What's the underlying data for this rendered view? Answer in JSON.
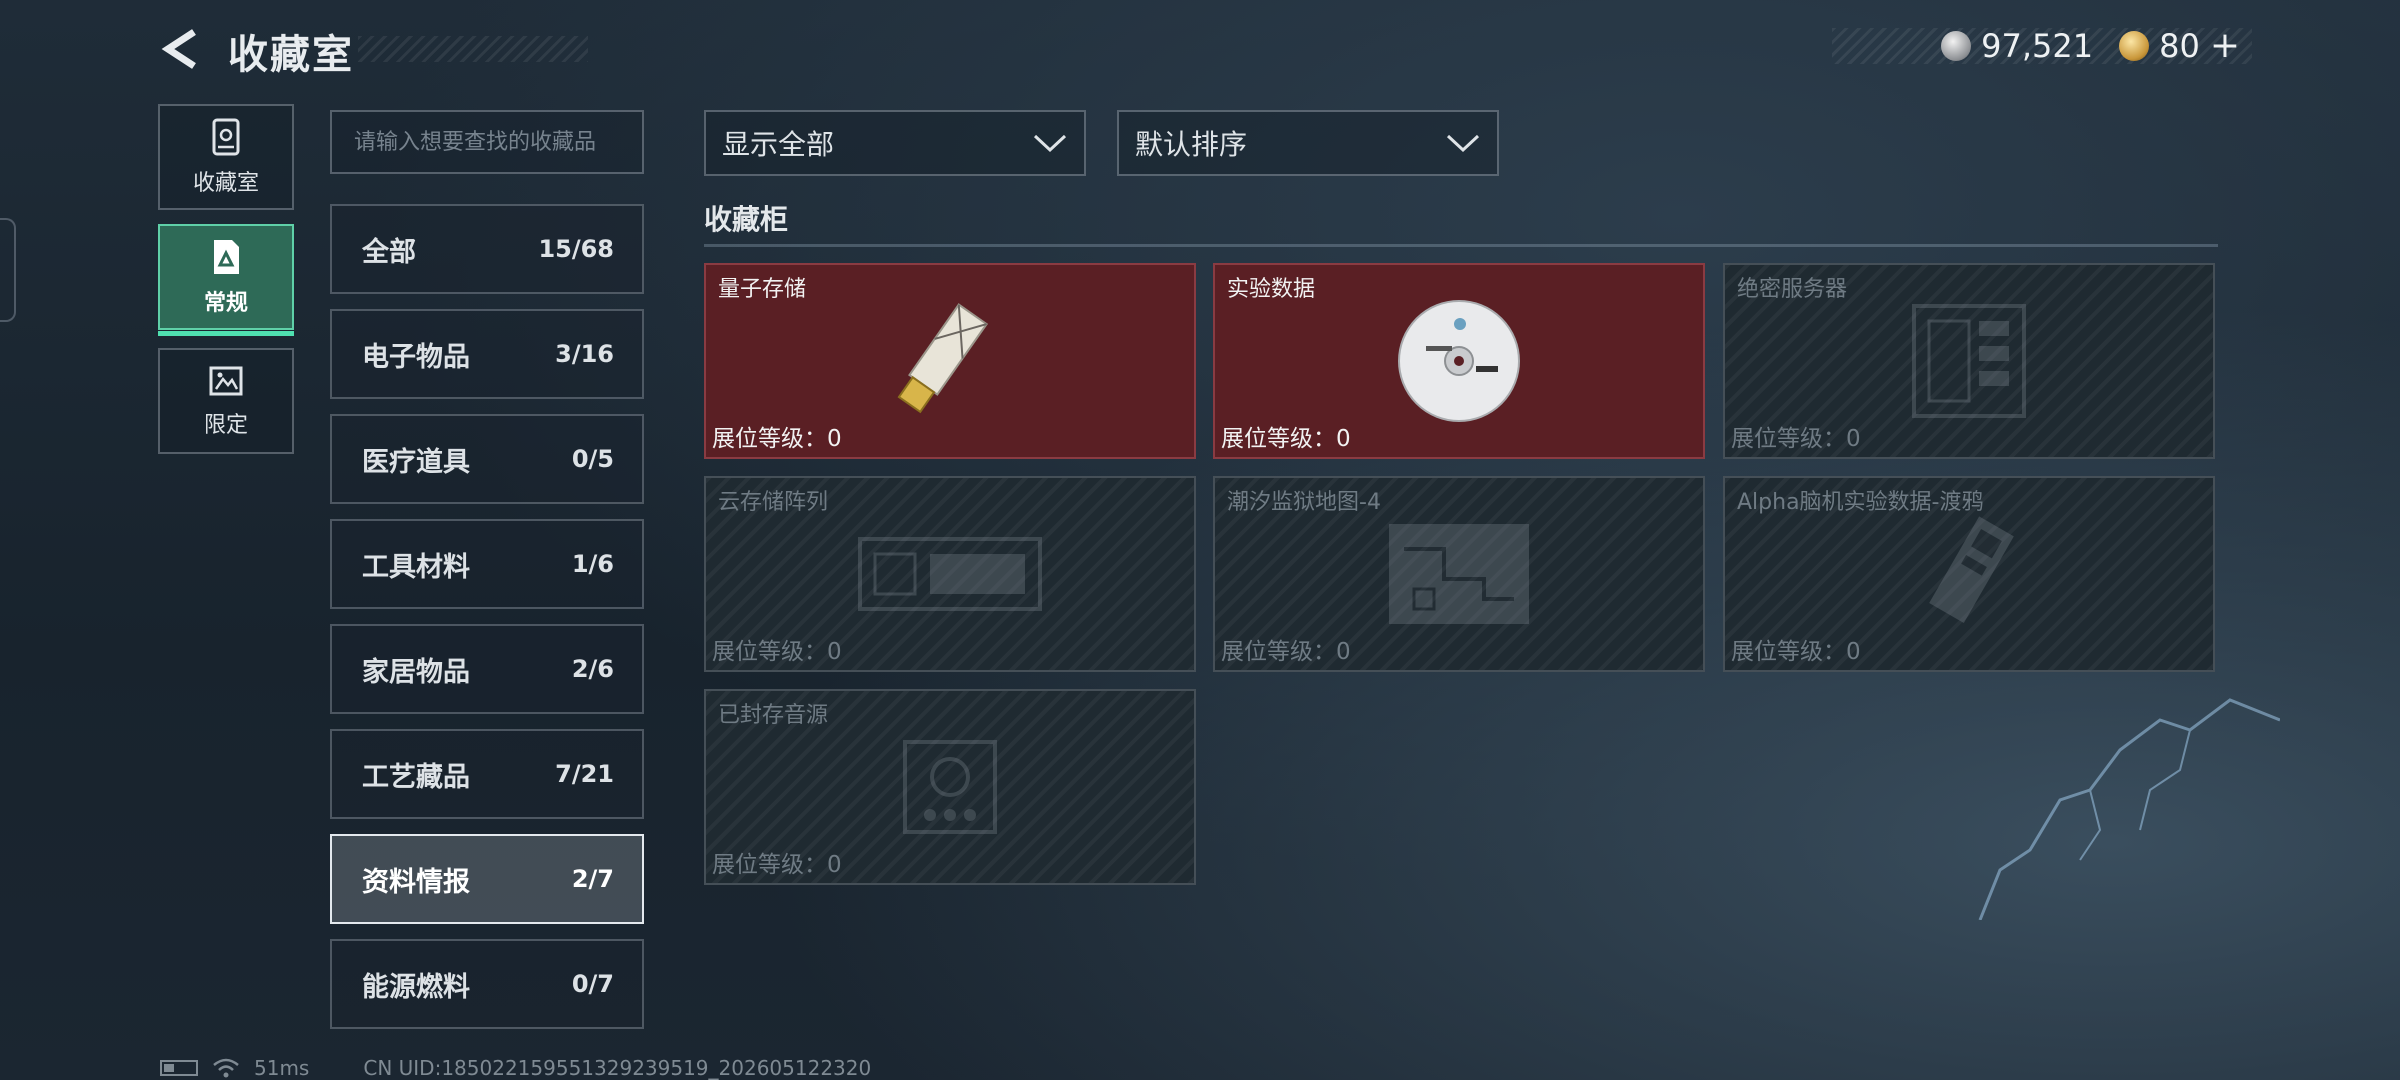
{
  "header": {
    "title": "收藏室",
    "currencies": [
      {
        "icon": "silver-coin-icon",
        "value": "97,521"
      },
      {
        "icon": "gold-coin-icon",
        "value": "80"
      }
    ],
    "add_label": "+"
  },
  "nav": [
    {
      "label": "收藏室",
      "icon": "trophy-case-icon",
      "active": false
    },
    {
      "label": "常规",
      "icon": "document-icon",
      "active": true
    },
    {
      "label": "限定",
      "icon": "limited-icon",
      "active": false
    }
  ],
  "search": {
    "placeholder": "请输入想要查找的收藏品",
    "value": ""
  },
  "categories": [
    {
      "name": "全部",
      "count": "15/68"
    },
    {
      "name": "电子物品",
      "count": "3/16"
    },
    {
      "name": "医疗道具",
      "count": "0/5"
    },
    {
      "name": "工具材料",
      "count": "1/6"
    },
    {
      "name": "家居物品",
      "count": "2/6"
    },
    {
      "name": "工艺藏品",
      "count": "7/21"
    },
    {
      "name": "资料情报",
      "count": "2/7"
    },
    {
      "name": "能源燃料",
      "count": "0/7"
    }
  ],
  "active_category": "资料情报",
  "filters": {
    "display": "显示全部",
    "sort": "默认排序"
  },
  "section_title": "收藏柜",
  "cards": [
    {
      "name": "量子存储",
      "level": "展位等级：0",
      "owned": true,
      "art": "usb-drive-icon"
    },
    {
      "name": "实验数据",
      "level": "展位等级：0",
      "owned": true,
      "art": "disc-icon"
    },
    {
      "name": "绝密服务器",
      "level": "展位等级：0",
      "owned": false,
      "art": "server-icon"
    },
    {
      "name": "云存储阵列",
      "level": "展位等级：0",
      "owned": false,
      "art": "storage-array-icon"
    },
    {
      "name": "潮汐监狱地图-4",
      "level": "展位等级：0",
      "owned": false,
      "art": "map-icon"
    },
    {
      "name": "Alpha脑机实验数据-渡鸦",
      "level": "展位等级：0",
      "owned": false,
      "art": "brain-chip-icon"
    },
    {
      "name": "已封存音源",
      "level": "展位等级：0",
      "owned": false,
      "art": "audio-source-icon"
    }
  ],
  "footer": {
    "ping": "51ms",
    "uid": "CN UID:1850221595513292395​19_202605122320"
  },
  "colors": {
    "owned_card": "#5a1f24",
    "active_nav": "#2e6a57",
    "accent": "#4fe0b0"
  }
}
